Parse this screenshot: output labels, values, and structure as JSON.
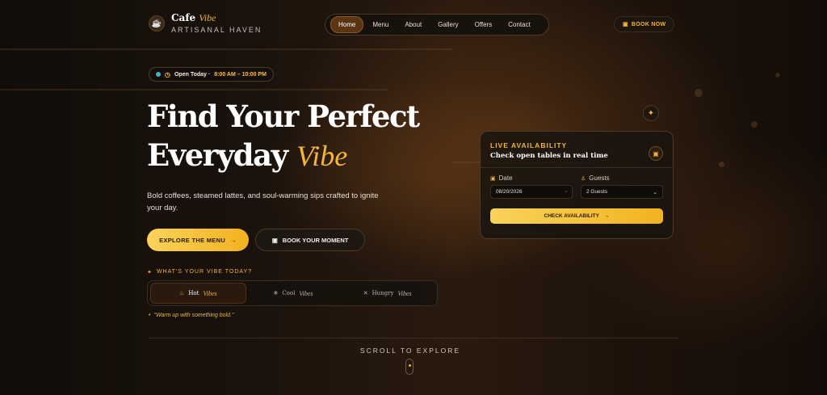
{
  "brand": {
    "name": "Cafe",
    "name_accent": "Vibe",
    "tagline": "ARTISANAL HAVEN",
    "icon": "coffee-cup-icon"
  },
  "nav": {
    "items": [
      {
        "label": "Home",
        "active": true
      },
      {
        "label": "Menu",
        "active": false
      },
      {
        "label": "About",
        "active": false
      },
      {
        "label": "Gallery",
        "active": false
      },
      {
        "label": "Offers",
        "active": false
      },
      {
        "label": "Contact",
        "active": false
      }
    ]
  },
  "header": {
    "book_now": "BOOK NOW",
    "book_icon": "calendar-icon"
  },
  "status": {
    "open_label": "Open Today ·",
    "hours": "8:00 AM – 10:00 PM",
    "icon": "clock-icon"
  },
  "hero": {
    "line1": "Find Your Perfect",
    "line2": "Everyday",
    "accent": "Vibe",
    "subtitle": "Bold coffees, steamed lattes, and soul-warming sips crafted to ignite your day.",
    "explore_button": "EXPLORE THE MENU",
    "book_button": "BOOK YOUR MOMENT"
  },
  "vibe_picker": {
    "label": "WHAT'S YOUR VIBE TODAY?",
    "options": [
      {
        "word": "Hot",
        "accent": "Vibes",
        "icon": "flame-icon",
        "active": true
      },
      {
        "word": "Cool",
        "accent": "Vibes",
        "icon": "snowflake-icon",
        "active": false
      },
      {
        "word": "Hungry",
        "accent": "Vibes",
        "icon": "utensils-icon",
        "active": false
      }
    ],
    "quote": "\"Warm up with something bold.\""
  },
  "availability": {
    "eyebrow": "LIVE AVAILABILITY",
    "title": "Check open tables in real time",
    "date_label": "Date",
    "date_value": "08/20/2026",
    "guests_label": "Guests",
    "guests_value": "2 Guests",
    "button": "CHECK AVAILABILITY"
  },
  "scroll": {
    "label": "SCROLL TO EXPLORE"
  },
  "colors": {
    "accent": "#f3b53a",
    "background": "#1a120c",
    "text": "#f3ece2"
  }
}
